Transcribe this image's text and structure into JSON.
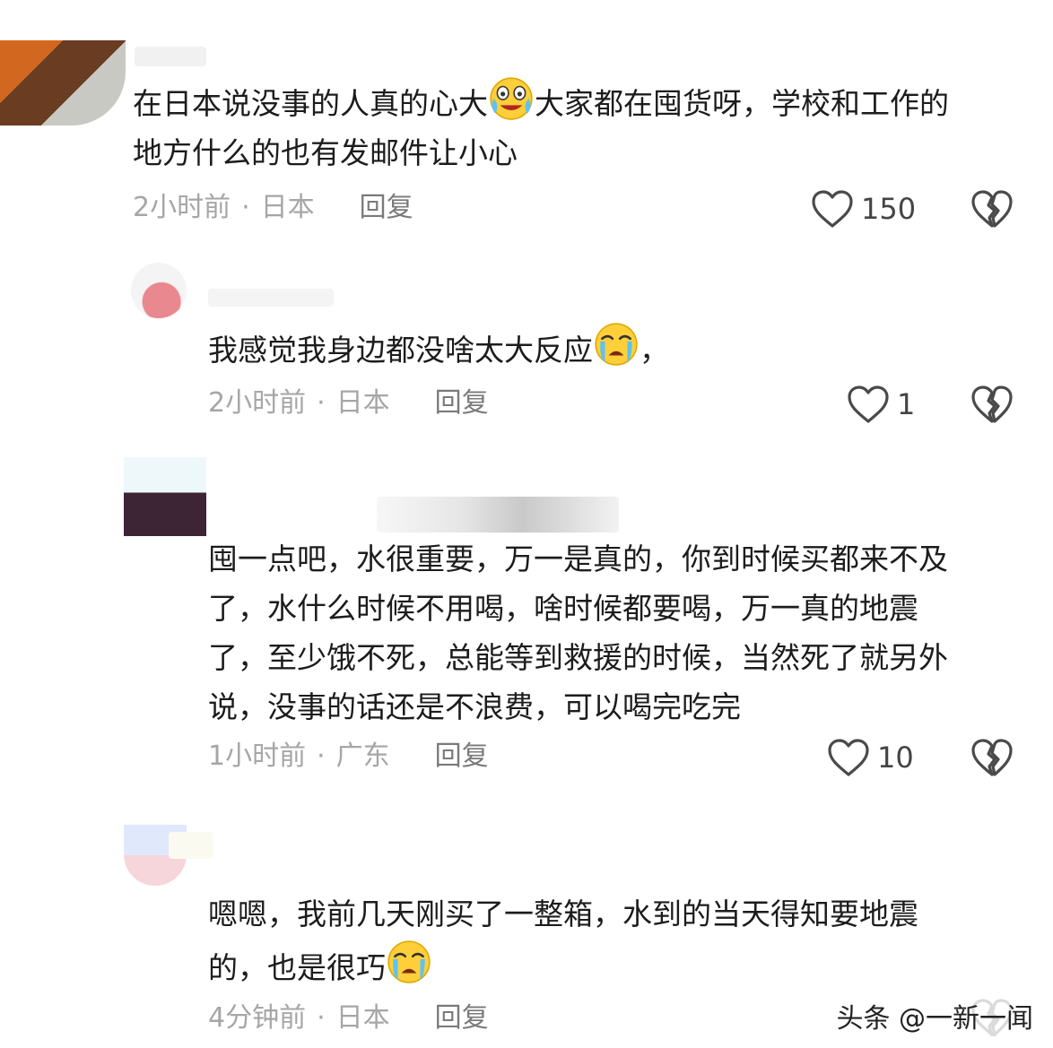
{
  "comments": [
    {
      "text_before": "在日本说没事的人真的心大",
      "text_after": "大家都在囤货呀，学校和工作的\n地方什么的也有发邮件让小心",
      "time": "2小时前",
      "location": "日本",
      "reply_label": "回复",
      "likes": "150"
    },
    {
      "text_before": "我感觉我身边都没啥太大反应",
      "text_after": "，",
      "time": "2小时前",
      "location": "日本",
      "reply_label": "回复",
      "likes": "1"
    },
    {
      "text": "囤一点吧，水很重要，万一是真的，你到时候买都来不及\n了，水什么时候不用喝，啥时候都要喝，万一真的地震\n了，至少饿不死，总能等到救援的时候，当然死了就另外\n说，没事的话还是不浪费，可以喝完吃完",
      "time": "1小时前",
      "location": "广东",
      "reply_label": "回复",
      "likes": "10"
    },
    {
      "text_line1": "嗯嗯，我前几天刚买了一整箱，水到的当天得知要地震",
      "text_line2": "的，也是很巧",
      "time": "4分钟前",
      "location": "日本",
      "reply_label": "回复"
    }
  ],
  "separator": "·",
  "watermark": "头条 @一新一闻",
  "icons": {
    "like": "heart-outline-icon",
    "dislike": "broken-heart-icon",
    "emoji_1": "crying-laughing-emoji",
    "emoji_2": "loudly-crying-emoji"
  }
}
